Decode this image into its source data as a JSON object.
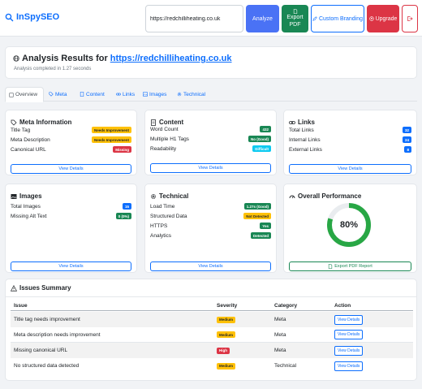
{
  "header": {
    "brand": "InSpySEO",
    "url_value": "https://redchilliheating.co.uk",
    "analyze": "Analyze",
    "export_pdf_line1": "Export",
    "export_pdf_line2": "PDF",
    "custom_branding": "Custom Branding",
    "upgrade": "Upgrade"
  },
  "results": {
    "title_prefix": "Analysis Results for",
    "title_link": "https://redchilliheating.co.uk",
    "completed": "Analysis completed in 1.27 seconds"
  },
  "tabs": [
    "Overview",
    "Meta",
    "Content",
    "Links",
    "Images",
    "Technical"
  ],
  "meta": {
    "title": "Meta Information",
    "rows": [
      {
        "label": "Title Tag",
        "badge": "Needs Improvement"
      },
      {
        "label": "Meta Description",
        "badge": "Needs Improvement"
      },
      {
        "label": "Canonical URL",
        "badge": "Missing"
      }
    ],
    "button": "View Details"
  },
  "content": {
    "title": "Content",
    "rows": [
      {
        "label": "Word Count",
        "badge": "432"
      },
      {
        "label": "Multiple H1 Tags",
        "badge": "No (Good)"
      },
      {
        "label": "Readability",
        "badge": "Difficult"
      }
    ],
    "button": "View Details"
  },
  "links": {
    "title": "Links",
    "rows": [
      {
        "label": "Total Links",
        "badge": "32"
      },
      {
        "label": "Internal Links",
        "badge": "24"
      },
      {
        "label": "External Links",
        "badge": "8"
      }
    ],
    "button": "View Details"
  },
  "images": {
    "title": "Images",
    "rows": [
      {
        "label": "Total Images",
        "badge": "15"
      },
      {
        "label": "Missing Alt Text",
        "badge": "0 (0%)"
      }
    ],
    "button": "View Details"
  },
  "technical": {
    "title": "Technical",
    "rows": [
      {
        "label": "Load Time",
        "badge": "1.27s (Good)"
      },
      {
        "label": "Structured Data",
        "badge": "Not Detected"
      },
      {
        "label": "HTTPS",
        "badge": "Yes"
      },
      {
        "label": "Analytics",
        "badge": "Detected"
      }
    ],
    "button": "View Details"
  },
  "performance": {
    "title": "Overall Performance",
    "score": "80%",
    "score_fraction": 0.8,
    "button": "Export PDF Report"
  },
  "issues": {
    "title": "Issues Summary",
    "headers": [
      "Issue",
      "Severity",
      "Category",
      "Action"
    ],
    "rows": [
      {
        "issue": "Title tag needs improvement",
        "severity": "Medium",
        "category": "Meta",
        "action": "View Details"
      },
      {
        "issue": "Meta description needs improvement",
        "severity": "Medium",
        "category": "Meta",
        "action": "View Details"
      },
      {
        "issue": "Missing canonical URL",
        "severity": "High",
        "category": "Meta",
        "action": "View Details"
      },
      {
        "issue": "No structured data detected",
        "severity": "Medium",
        "category": "Technical",
        "action": "View Details"
      }
    ]
  },
  "colors": {
    "primary": "#0d6efd",
    "analyze": "#4a72f5",
    "success": "#198754",
    "danger": "#dc3545",
    "warning": "#ffc107",
    "info": "#0dcaf0"
  }
}
